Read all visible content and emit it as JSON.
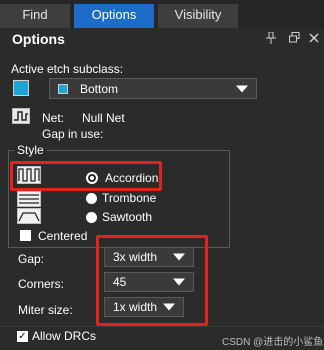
{
  "tabs": [
    {
      "label": "Find",
      "active": false
    },
    {
      "label": "Options",
      "active": true
    },
    {
      "label": "Visibility",
      "active": false
    }
  ],
  "panel": {
    "title": "Options",
    "buttons": {
      "pin": "pin-icon",
      "float": "float-icon",
      "close": "close-icon"
    }
  },
  "subclass": {
    "label": "Active etch subclass:",
    "swatch_color": "#1ea4d6",
    "value": "Bottom"
  },
  "net": {
    "label": "Net:",
    "value": "Null Net",
    "gap_label": "Gap in use:"
  },
  "style": {
    "group_label": "Style",
    "options": [
      {
        "label": "Accordion",
        "checked": true
      },
      {
        "label": "Trombone",
        "checked": false
      },
      {
        "label": "Sawtooth",
        "checked": false
      }
    ],
    "centered_label": "Centered",
    "centered_checked": false
  },
  "params": {
    "gap": {
      "label": "Gap:",
      "value": "3x width"
    },
    "corners": {
      "label": "Corners:",
      "value": "45"
    },
    "miter": {
      "label": "Miter size:",
      "value": "1x width"
    }
  },
  "allow_drcs": {
    "label": "Allow DRCs",
    "checked": true
  },
  "watermark": "CSDN @进击的小鲨鱼",
  "colors": {
    "accent": "#1d6cc7",
    "highlight": "#e3241b",
    "swatch": "#1ea4d6"
  }
}
